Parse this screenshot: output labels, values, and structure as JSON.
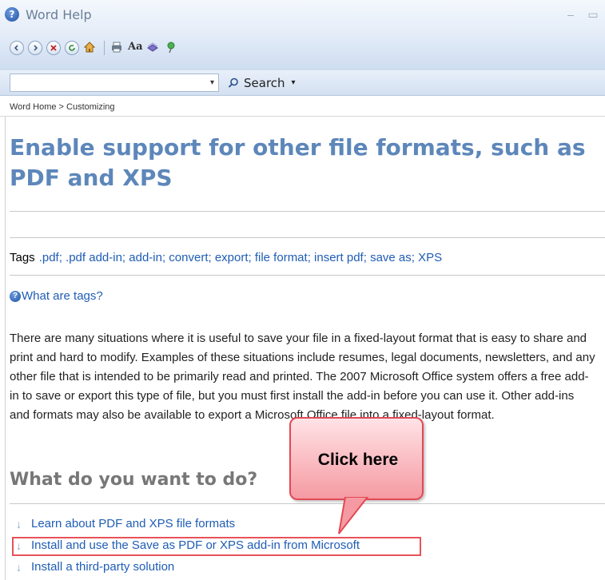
{
  "window": {
    "title": "Word Help",
    "minimize": "–",
    "restore": "▭"
  },
  "toolbar": {
    "buttons": [
      "back-icon",
      "forward-icon",
      "stop-icon",
      "refresh-icon",
      "home-icon",
      "print-icon",
      "font-size-icon",
      "table-of-contents-icon",
      "keep-on-top-icon"
    ]
  },
  "search": {
    "value": "",
    "button_label": "Search",
    "dropdown_glyph": "▾"
  },
  "breadcrumb": "Word Home > Customizing",
  "article": {
    "title": "Enable support for other file formats, such as PDF and XPS",
    "tags_label": "Tags",
    "tags": ".pdf; .pdf add-in; add-in; convert; export; file format; insert pdf; save as; XPS",
    "what_are_tags": "What are tags?",
    "paragraph": "There are many situations where it is useful to save your file in a fixed-layout format that is easy to share and print and hard to modify. Examples of these situations include resumes, legal documents, newsletters, and any other file that is intended to be primarily read and printed. The 2007 Microsoft Office system offers a free add-in to save or export this type of file, but you must first install the add-in before you can use it. Other add-ins and formats may also be available to export a Microsoft Office file into a fixed-layout format.",
    "section_heading": "What do you want to do?",
    "links": [
      "Learn about PDF and XPS file formats",
      "Install and use the Save as PDF or XPS add-in from Microsoft",
      "Install a third-party solution"
    ]
  },
  "callout": {
    "text": "Click here",
    "colors": {
      "border": "#e24955",
      "fill": "#f59aa2"
    }
  },
  "colors": {
    "title": "#5d87ba",
    "link": "#1f5db5",
    "highlight": "#e8525a"
  }
}
